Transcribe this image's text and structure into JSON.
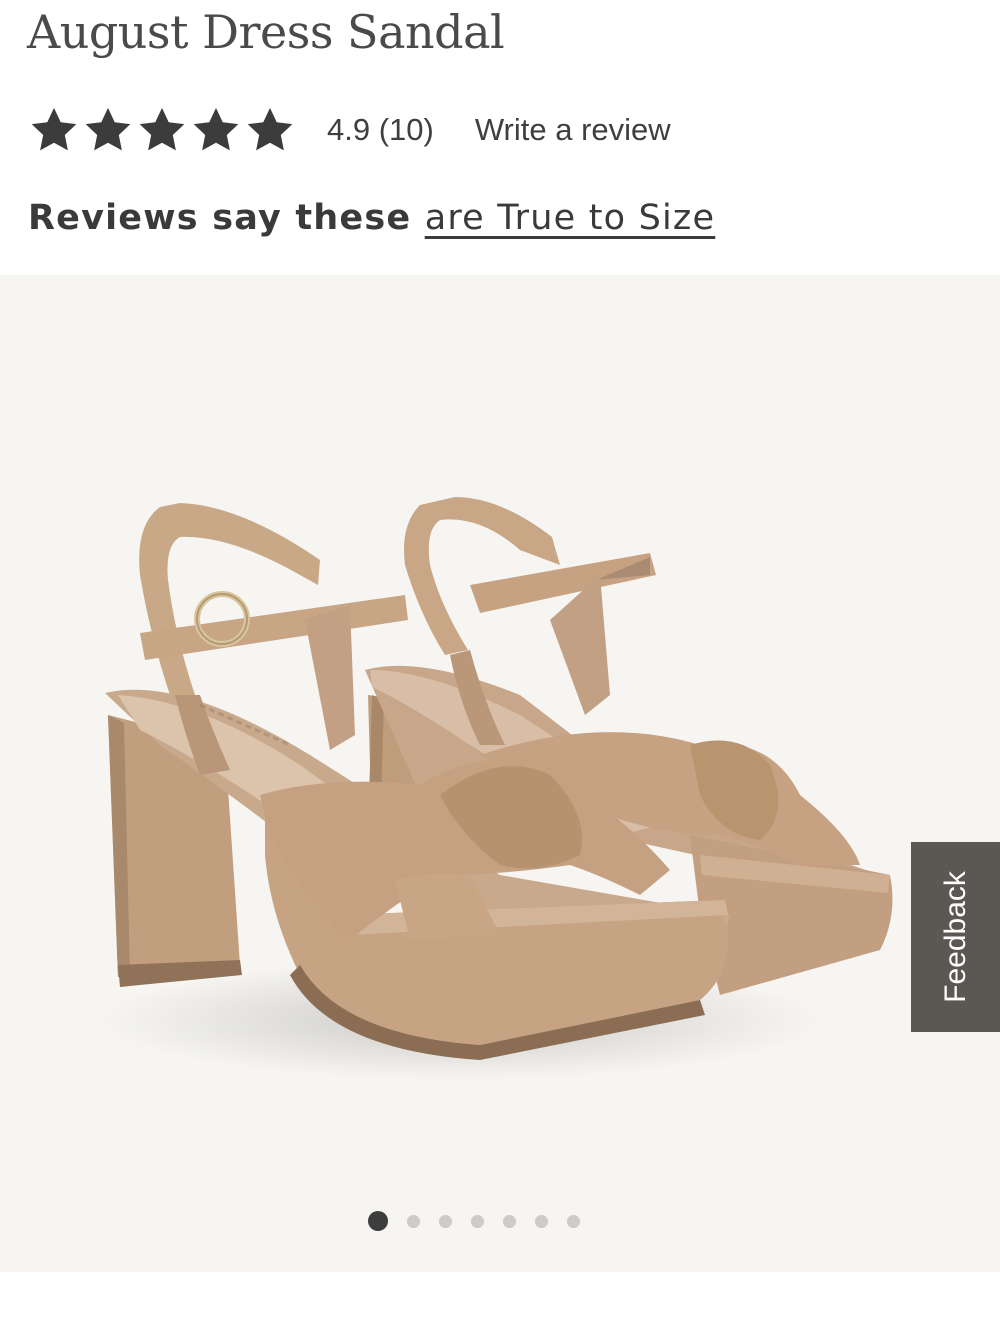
{
  "product": {
    "title": "August Dress Sandal"
  },
  "rating": {
    "stars": 5,
    "summary": "4.9 (10)",
    "write_review_label": "Write a review"
  },
  "fit": {
    "prefix": "Reviews say these",
    "link_text": "are True to Size"
  },
  "gallery": {
    "slide_count": 7,
    "active_index": 0
  },
  "feedback": {
    "label": "Feedback"
  },
  "colors": {
    "gallery_bg": "#f6f5f1",
    "star": "#3c3c3c",
    "feedback_bg": "#5b5753",
    "sandal": "#c9a888"
  },
  "icons": {
    "star": "star-icon"
  }
}
